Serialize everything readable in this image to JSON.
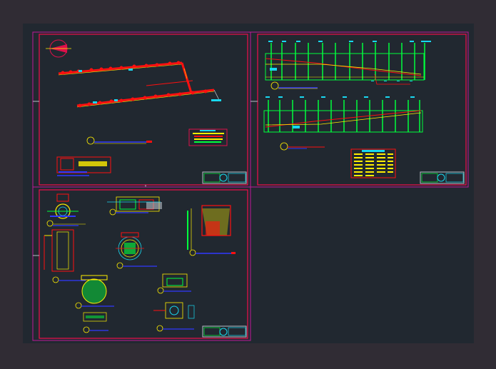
{
  "app": {
    "viewport_background": "#302c34",
    "model_space_background": "#212830"
  },
  "sheets": [
    {
      "id": "site-plan",
      "label": ""
    },
    {
      "id": "profiles",
      "label": ""
    },
    {
      "id": "details",
      "label": ""
    }
  ],
  "colors": {
    "frame_red": "#e0104a",
    "frame_magenta": "#c01898",
    "line_green": "#00ff3c",
    "line_cyan": "#18d8f0",
    "line_yellow": "#ffee00",
    "line_red": "#ff1010",
    "line_blue": "#3038ff",
    "titleblock_grey": "#b8c0c8"
  },
  "icons": [
    "north-arrow-icon",
    "section-marker-icon",
    "titleblock-logo-icon"
  ]
}
